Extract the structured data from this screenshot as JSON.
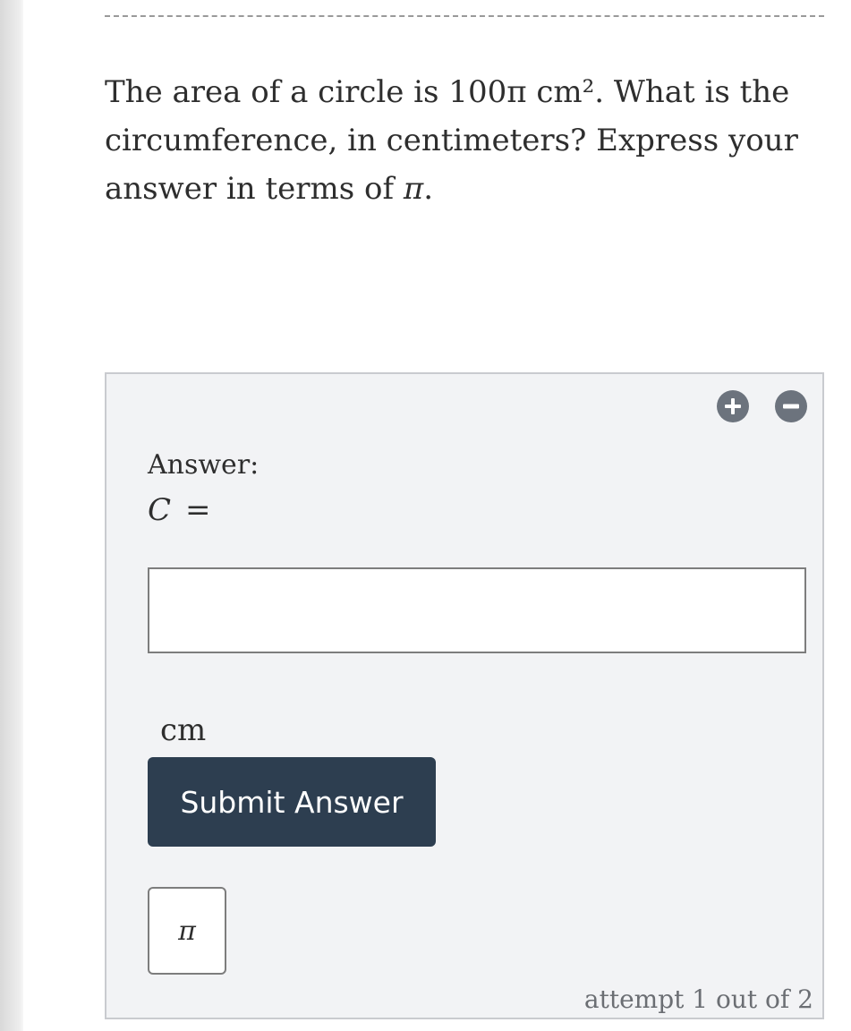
{
  "question": {
    "text_part1": "The area of a circle is 100π cm². What is the circumference, in centimeters? Express your answer in terms of ",
    "pi_symbol": "π",
    "text_end": "."
  },
  "answer_panel": {
    "label": "Answer:",
    "formula_variable": "C",
    "formula_equals": "=",
    "input_value": "",
    "unit": "cm",
    "submit_label": "Submit Answer",
    "pi_key_label": "π",
    "attempt_text": "attempt 1 out of 2",
    "icons": {
      "add": "plus-circle-icon",
      "remove": "minus-circle-icon"
    }
  },
  "colors": {
    "submit_button_bg": "#2d3e50",
    "panel_bg": "#f2f3f5",
    "icon_bg": "#6c737d"
  }
}
